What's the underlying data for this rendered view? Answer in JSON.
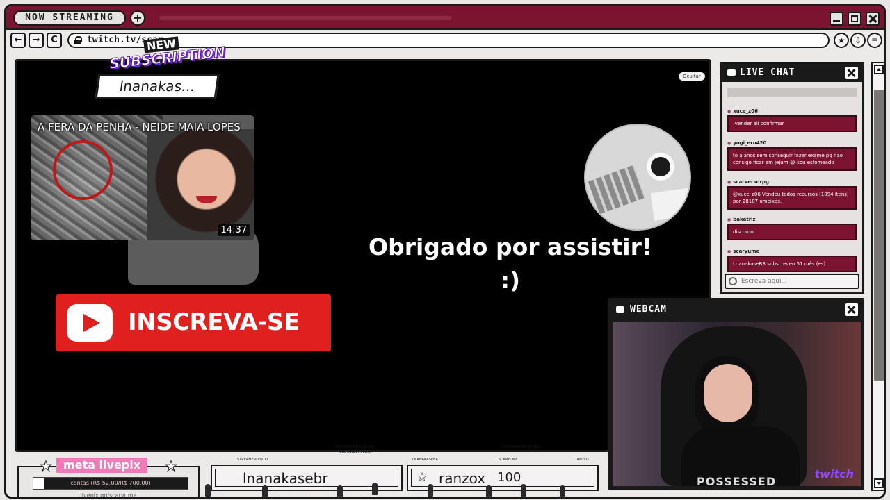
{
  "titlebar": {
    "badge": "NOW STREAMING",
    "plus": "+"
  },
  "browser": {
    "back": "←",
    "forward": "→",
    "reload": "C",
    "url": "twitch.tv/scar",
    "favorite_icon": "star-icon",
    "download_icon": "download-icon",
    "menu_icon": "menu-icon"
  },
  "subscription": {
    "new_label": "NEW",
    "title": "SUBSCRIPTION",
    "username": "lnanakas..."
  },
  "stream": {
    "hide_label": "Ocultar",
    "video_title": "A FERA DA PENHA - NEIDE MAIA LOPES",
    "video_duration": "14:37",
    "subscribe_label": "INSCREVA-SE",
    "thanks_line1": "Obrigado por assistir!",
    "thanks_line2": ":)"
  },
  "chat": {
    "title": "LIVE CHAT",
    "input_placeholder": "Escreva aqui...",
    "messages": [
      {
        "user": "xuce_z06",
        "text": "!vender all confirmar"
      },
      {
        "user": "yogi_eru420",
        "text": "to a anos sem conseguir fazer exame pq nao consigo ficar em jejum 😭 sou esfomeado"
      },
      {
        "user": "scarversorpg",
        "text": "@xuce_z06 Vendeu todos recursos (1094 itens) por 28187 umeixas."
      },
      {
        "user": "bakatriz",
        "text": "discordo"
      },
      {
        "user": "scaryume",
        "text": "LnanakaseBR subscreveu 51 mês (es)"
      }
    ]
  },
  "webcam": {
    "title": "WEBCAM",
    "shirt_text": "POSSESSED",
    "brand": "twitch"
  },
  "goal": {
    "title": "meta livepix",
    "progress_text": "contas (R$ 52,00/R$ 700,00)",
    "progress_fraction": 0.074,
    "url": "livepix.gg/scaryume"
  },
  "bottom": {
    "box1_name": "lnanakasebr",
    "box2_name": "ranzox",
    "box2_count": "100",
    "labels": [
      "MAJORDOME AURORA",
      "MANDATARIO PNUEL",
      "COMANDANTE NADER",
      "STREAMERLENTO",
      "LNANAKASEBR",
      "SCARYUME",
      "TANZOX"
    ]
  },
  "colors": {
    "accent": "#7a1430",
    "youtube_red": "#e01f1f",
    "goal_pink": "#f07ab8",
    "twitch_purple": "#9146ff"
  }
}
